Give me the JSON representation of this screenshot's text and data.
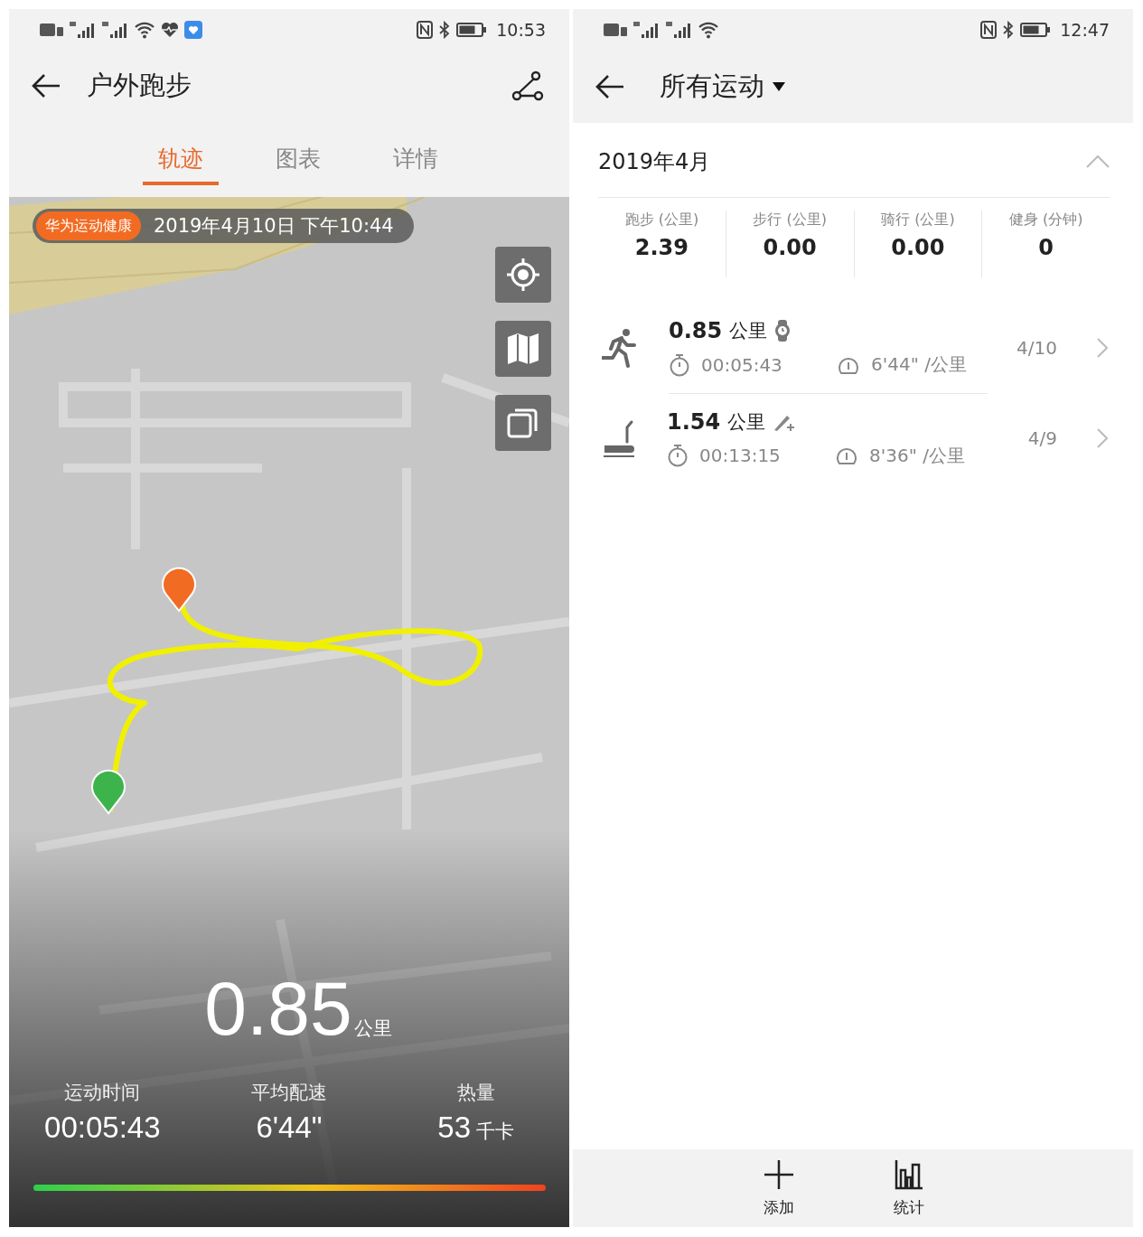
{
  "left_screen": {
    "status_bar": {
      "time": "10:53"
    },
    "header": {
      "title": "户外跑步"
    },
    "tabs": [
      {
        "label": "轨迹",
        "selected": true
      },
      {
        "label": "图表",
        "selected": false
      },
      {
        "label": "详情",
        "selected": false
      }
    ],
    "map": {
      "source_badge": "华为运动健康",
      "datetime": "2019年4月10日 下午10:44",
      "distance": "0.85",
      "distance_unit": "公里",
      "stats": [
        {
          "label": "运动时间",
          "value": "00:05:43"
        },
        {
          "label": "平均配速",
          "value": "6'44\""
        },
        {
          "label": "热量",
          "value": "53",
          "unit": "千卡"
        }
      ]
    }
  },
  "right_screen": {
    "status_bar": {
      "time": "12:47"
    },
    "header": {
      "title": "所有运动"
    },
    "month": {
      "title": "2019年4月",
      "expanded": true
    },
    "summary": [
      {
        "label": "跑步 (公里)",
        "value": "2.39"
      },
      {
        "label": "步行 (公里)",
        "value": "0.00"
      },
      {
        "label": "骑行 (公里)",
        "value": "0.00"
      },
      {
        "label": "健身 (分钟)",
        "value": "0"
      }
    ],
    "activities": [
      {
        "kind": "outdoor_run",
        "badge": {
          "kind": "watch"
        },
        "distance": "0.85",
        "unit": "公里",
        "duration": "00:05:43",
        "pace": "6'44\" /公里",
        "date": "4/10"
      },
      {
        "kind": "treadmill",
        "badge": {
          "kind": "manual"
        },
        "distance": "1.54",
        "unit": "公里",
        "duration": "00:13:15",
        "pace": "8'36\" /公里",
        "date": "4/9"
      }
    ],
    "bottom_bar": [
      {
        "kind": "add",
        "label": "添加"
      },
      {
        "kind": "stats",
        "label": "统计"
      }
    ]
  }
}
